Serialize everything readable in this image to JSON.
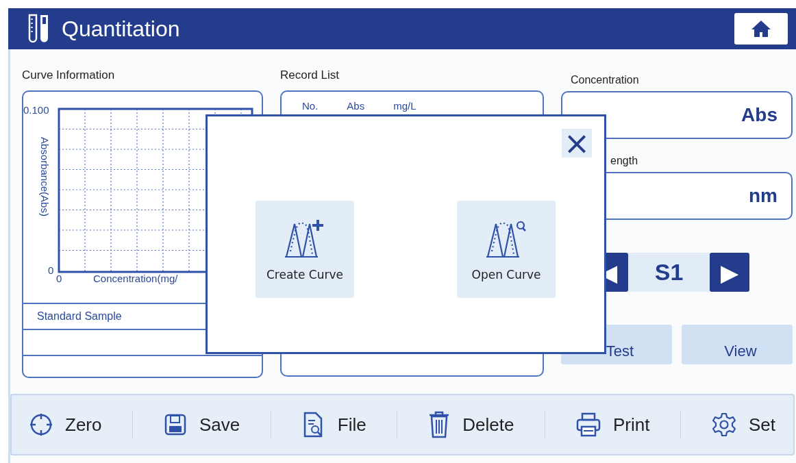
{
  "header": {
    "title": "Quantitation"
  },
  "curve_info": {
    "label": "Curve Information",
    "chart": {
      "y_max": "0.100",
      "y_min": "0",
      "x_min": "0",
      "ylabel": "Absorbance(Abs)",
      "xlabel": "Concentration(mg/"
    },
    "table_header": "Standard Sample"
  },
  "record_list": {
    "label": "Record List",
    "columns": [
      "No.",
      "Abs",
      "mg/L"
    ]
  },
  "concentration": {
    "label": "Concentration",
    "unit": "Abs"
  },
  "wavelength": {
    "label": "ength",
    "unit": "nm"
  },
  "sample_nav": {
    "prev": "◀",
    "value": "S1",
    "next": "▶"
  },
  "actions": [
    "Test",
    "View"
  ],
  "toolbar": [
    {
      "kind": "zero",
      "label": "Zero"
    },
    {
      "kind": "save",
      "label": "Save"
    },
    {
      "kind": "file",
      "label": "File"
    },
    {
      "kind": "delete",
      "label": "Delete"
    },
    {
      "kind": "print",
      "label": "Print"
    },
    {
      "kind": "set",
      "label": "Set"
    }
  ],
  "dialog": {
    "close": "×",
    "options": [
      {
        "kind": "create",
        "label": "Create Curve"
      },
      {
        "kind": "open",
        "label": "Open Curve"
      }
    ]
  }
}
